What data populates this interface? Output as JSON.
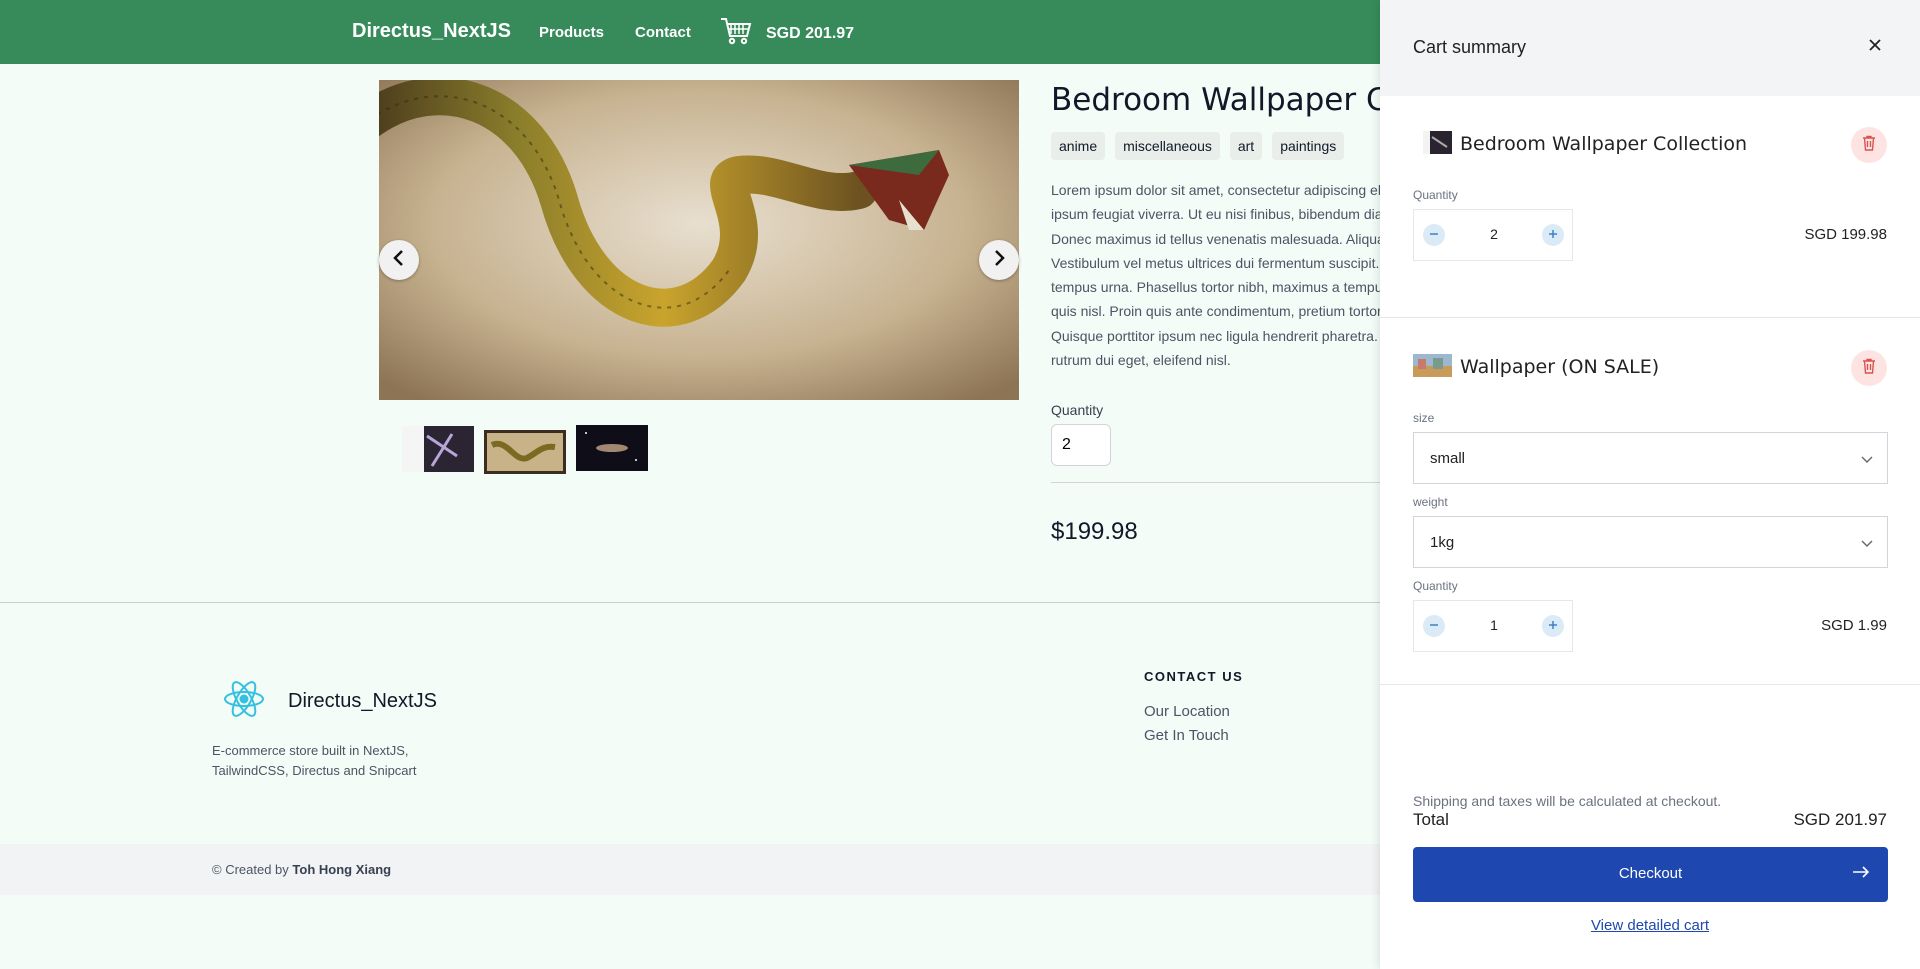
{
  "header": {
    "brand": "Directus_NextJS",
    "nav": [
      {
        "label": "Products"
      },
      {
        "label": "Contact"
      }
    ],
    "cart_total": "SGD 201.97",
    "bg_color": "#378b5b"
  },
  "product": {
    "title": "Bedroom Wallpaper Coll",
    "tags": [
      "anime",
      "miscellaneous",
      "art",
      "paintings"
    ],
    "description": "Lorem ipsum dolor sit amet, consectetur adipiscing el\nipsum feugiat viverra. Ut eu nisi finibus, bibendum dia\nDonec maximus id tellus venenatis malesuada. Aliqua\nVestibulum vel metus ultrices dui fermentum suscipit.\ntempus urna. Phasellus tortor nibh, maximus a tempu\nquis nisl. Proin quis ante condimentum, pretium tortor\nQuisque porttitor ipsum nec ligula hendrerit pharetra.\nrutrum dui eget, eleifend nisl.",
    "quantity_label": "Quantity",
    "quantity_value": "2",
    "price": "$199.98",
    "gallery": {
      "prev_icon": "chevron-left-icon",
      "next_icon": "chevron-right-icon",
      "thumbnails": [
        "archer-thumbnail",
        "snake-thumbnail",
        "galaxy-thumbnail"
      ],
      "active_thumbnail": 1
    }
  },
  "footer": {
    "brand": "Directus_NextJS",
    "description": "E-commerce store built in NextJS, TailwindCSS, Directus and Snipcart",
    "contact_title": "CONTACT US",
    "links": [
      {
        "label": "Our Location"
      },
      {
        "label": "Get In Touch"
      }
    ],
    "credit_prefix": "© Created by",
    "credit_name": "Toh Hong Xiang"
  },
  "cart": {
    "title": "Cart summary",
    "items": [
      {
        "name": "Bedroom Wallpaper Collection",
        "quantity_label": "Quantity",
        "quantity": "2",
        "price": "SGD 199.98"
      },
      {
        "name": "Wallpaper (ON SALE)",
        "size_label": "size",
        "size_value": "small",
        "weight_label": "weight",
        "weight_value": "1kg",
        "quantity_label": "Quantity",
        "quantity": "1",
        "price": "SGD 1.99"
      }
    ],
    "shipping_note": "Shipping and taxes will be calculated at checkout.",
    "total_label": "Total",
    "total_value": "SGD 201.97",
    "checkout_label": "Checkout",
    "detailed_link": "View detailed cart",
    "accent_color": "#1e48b0",
    "delete_color": "#fde4e2"
  }
}
